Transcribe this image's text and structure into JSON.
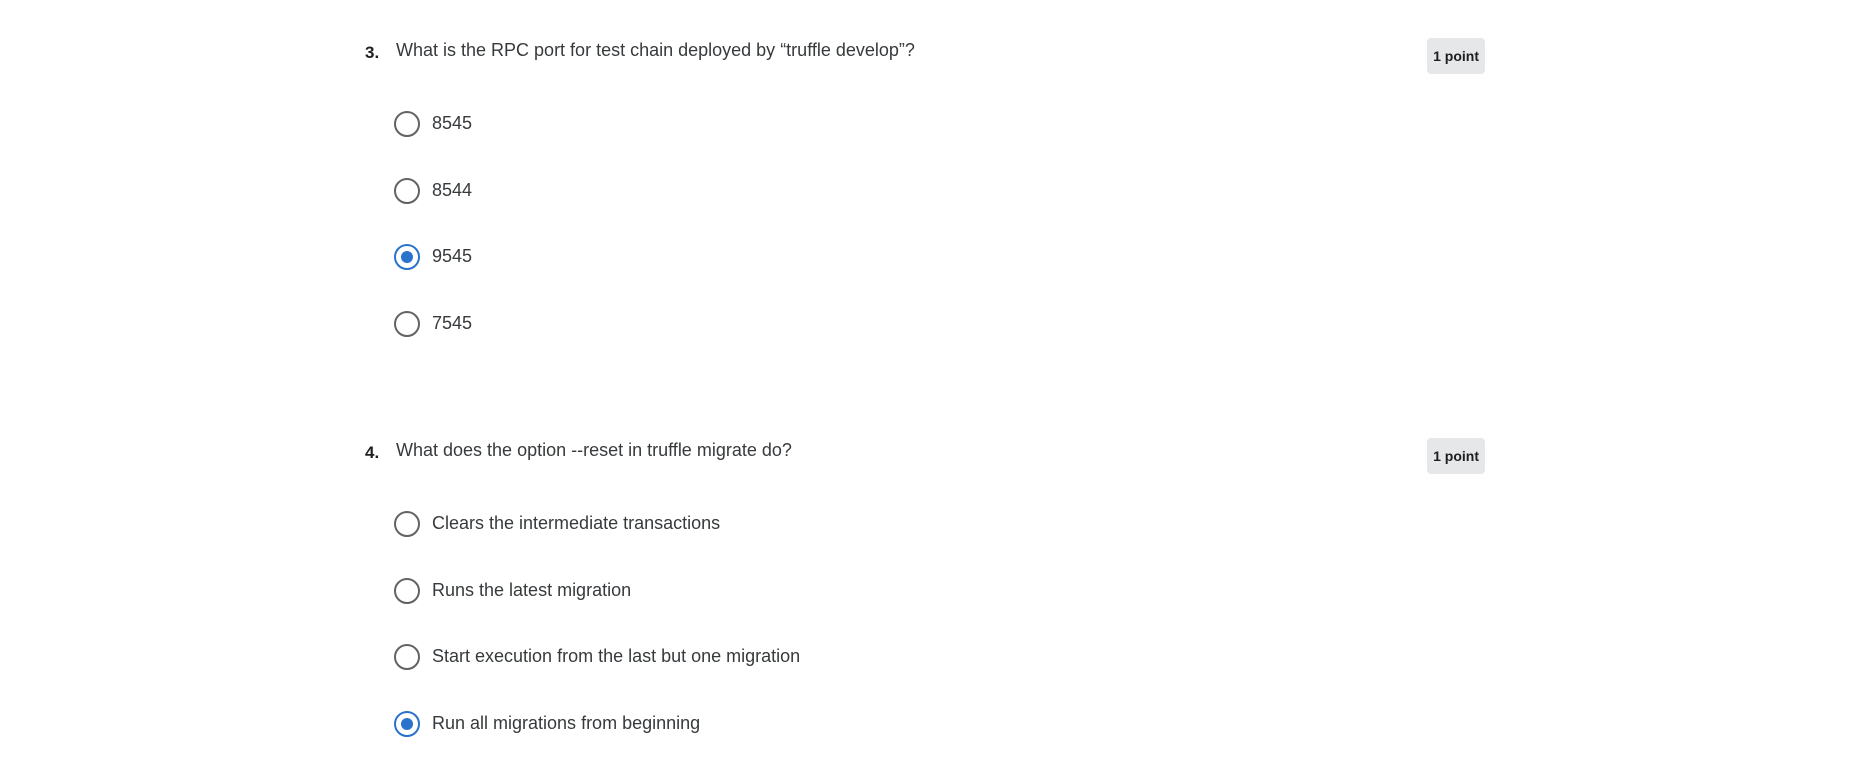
{
  "questions": [
    {
      "number": "3.",
      "text": "What is the RPC port for test chain deployed by “truffle develop”?",
      "points": "1 point",
      "options": [
        {
          "label": "8545",
          "selected": false
        },
        {
          "label": "8544",
          "selected": false
        },
        {
          "label": "9545",
          "selected": true
        },
        {
          "label": "7545",
          "selected": false
        }
      ]
    },
    {
      "number": "4.",
      "text": "What does the option --reset in truffle migrate do?",
      "points": "1 point",
      "options": [
        {
          "label": "Clears the intermediate transactions",
          "selected": false
        },
        {
          "label": "Runs the latest migration",
          "selected": false
        },
        {
          "label": "Start execution from the last but one migration",
          "selected": false
        },
        {
          "label": "Run all migrations from beginning",
          "selected": true
        }
      ]
    }
  ],
  "colors": {
    "accent": "#2a73cc",
    "radio_border": "#636363",
    "badge_bg": "#e5e7e8",
    "text": "#373a3c"
  }
}
